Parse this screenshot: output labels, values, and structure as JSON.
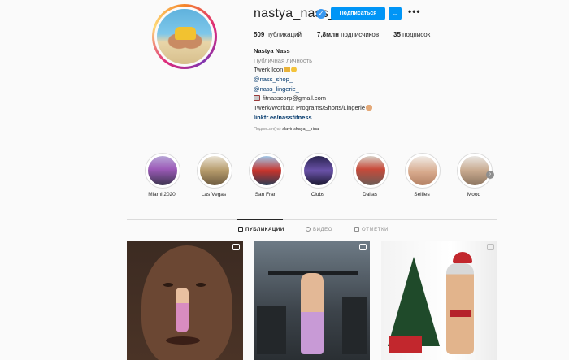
{
  "profile": {
    "username": "nastya_nass_",
    "verified_mark": "✓",
    "follow_label": "Подписаться",
    "dropdown_glyph": "⌄",
    "more_glyph": "•••"
  },
  "stats": {
    "posts_count": "509",
    "posts_label": "публикаций",
    "followers_count": "7,8млн",
    "followers_label": "подписчиков",
    "following_count": "35",
    "following_label": "подписок"
  },
  "bio": {
    "name": "Nastya Nass",
    "category": "Публичная личность",
    "line1": "Twerk Icon",
    "link_shop": "@nass_shop_",
    "link_lingerie": "@nass_lingerie_",
    "email": "fitnasscorp@gmail.com",
    "line_programs": "Twerk/Workout Programs/Shorts/Lingerie",
    "website": "linktr.ee/nassfitness",
    "followed_prefix": "Подписан(-а) ",
    "followed_user": "slavinskaya__irina"
  },
  "highlights": [
    {
      "label": "Miami 2020"
    },
    {
      "label": "Las Vegas"
    },
    {
      "label": "San Fran"
    },
    {
      "label": "Clubs"
    },
    {
      "label": "Dallas"
    },
    {
      "label": "Selfies"
    },
    {
      "label": "Mood"
    }
  ],
  "highlight_next_glyph": "›",
  "tabs": {
    "posts": "ПУБЛИКАЦИИ",
    "video": "ВИДЕО",
    "tagged": "ОТМЕТКИ"
  },
  "colors": {
    "accent": "#0095f6",
    "verified": "#3897f0",
    "link": "#00376b"
  }
}
